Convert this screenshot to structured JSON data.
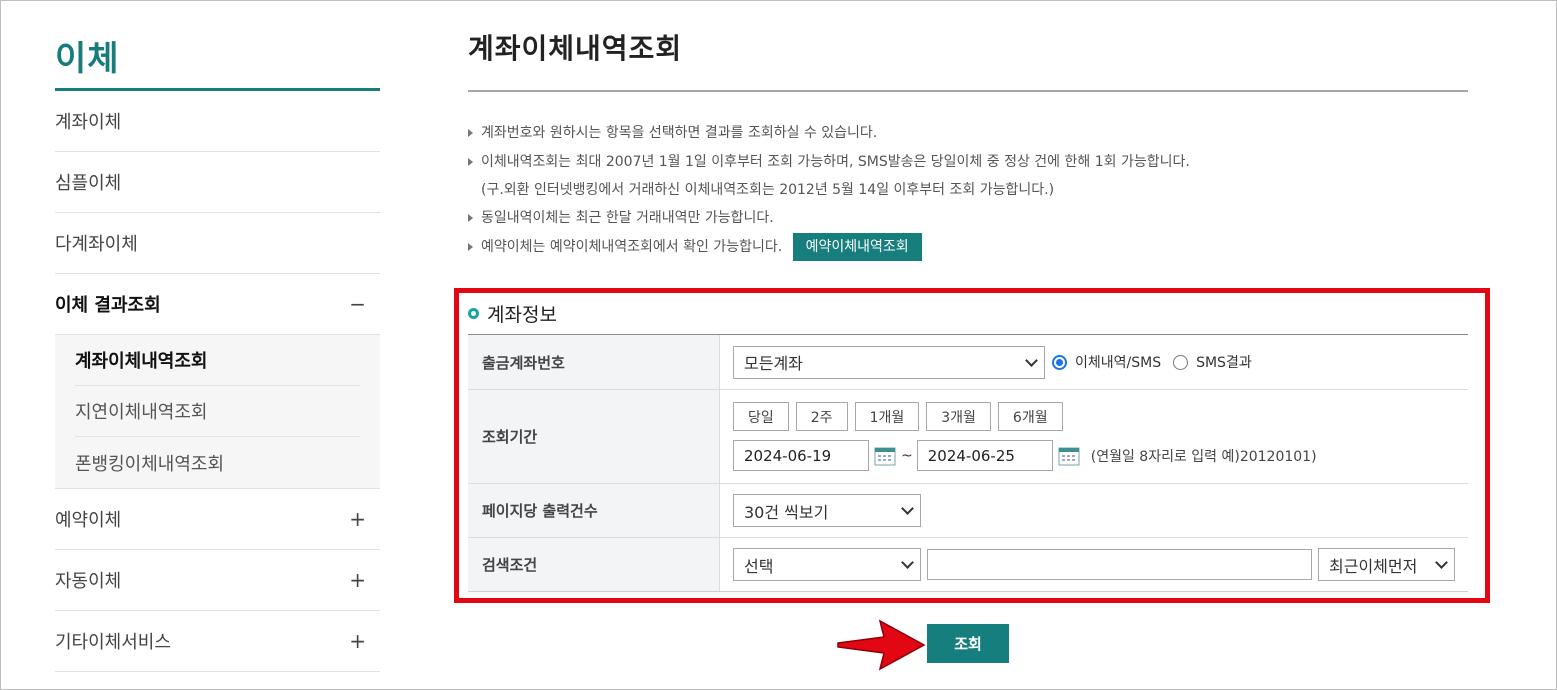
{
  "sidebar": {
    "title": "이체",
    "items": [
      {
        "label": "계좌이체",
        "toggle": ""
      },
      {
        "label": "심플이체",
        "toggle": ""
      },
      {
        "label": "다계좌이체",
        "toggle": ""
      },
      {
        "label": "이체 결과조회",
        "toggle": "−"
      },
      {
        "label": "예약이체",
        "toggle": "+"
      },
      {
        "label": "자동이체",
        "toggle": "+"
      },
      {
        "label": "기타이체서비스",
        "toggle": "+"
      }
    ],
    "submenu": [
      {
        "label": "계좌이체내역조회"
      },
      {
        "label": "지연이체내역조회"
      },
      {
        "label": "폰뱅킹이체내역조회"
      }
    ]
  },
  "main": {
    "title": "계좌이체내역조회",
    "notices": [
      "계좌번호와 원하시는 항목을 선택하면 결과를 조회하실 수 있습니다.",
      "이체내역조회는 최대 2007년 1월 1일 이후부터 조회 가능하며, SMS발송은 당일이체 중 정상 건에 한해 1회 가능합니다.",
      "(구.외환 인터넷뱅킹에서 거래하신 이체내역조회는 2012년 5월 14일 이후부터 조회 가능합니다.)",
      "동일내역이체는 최근 한달 거래내역만 가능합니다.",
      "예약이체는 예약이체내역조회에서 확인 가능합니다."
    ],
    "reservation_button": "예약이체내역조회",
    "section_title": "계좌정보",
    "form": {
      "account_label": "출금계좌번호",
      "account_value": "모든계좌",
      "radio_history": "이체내역/SMS",
      "radio_sms": "SMS결과",
      "period_label": "조회기간",
      "period_buttons": [
        "당일",
        "2주",
        "1개월",
        "3개월",
        "6개월"
      ],
      "date_from": "2024-06-19",
      "date_to": "2024-06-25",
      "date_sep": "~",
      "date_hint": "(연월일 8자리로 입력 예)20120101)",
      "page_size_label": "페이지당 출력건수",
      "page_size_value": "30건 씩보기",
      "search_label": "검색조건",
      "search_select": "선택",
      "search_text": "",
      "sort_value": "최근이체먼저"
    },
    "submit_label": "조회"
  },
  "colors": {
    "brand_teal": "#177e7e",
    "highlight_red": "#e30613",
    "radio_blue": "#1a73e8"
  }
}
